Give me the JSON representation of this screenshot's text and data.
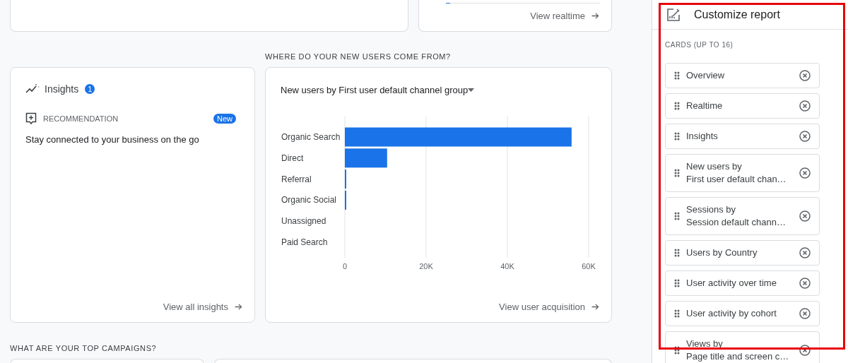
{
  "realtime_card": {
    "link": "View realtime"
  },
  "acquisition_section": {
    "heading": "WHERE DO YOUR NEW USERS COME FROM?",
    "insights_card": {
      "title": "Insights",
      "count": "1",
      "recommendation_label": "RECOMMENDATION",
      "badge": "New",
      "text": "Stay connected to your business on the go",
      "link": "View all insights"
    },
    "chart_card": {
      "title": "New users by First user default channel group",
      "link": "View user acquisition",
      "chart_data": {
        "type": "bar",
        "orientation": "horizontal",
        "categories": [
          "Organic Search",
          "Direct",
          "Referral",
          "Organic Social",
          "Unassigned",
          "Paid Search"
        ],
        "series": [
          {
            "color": "#1a73e8",
            "values": [
              55800,
              10400,
              300,
              300,
              0,
              0
            ]
          }
        ],
        "xlim": [
          0,
          60000
        ],
        "xticks": [
          {
            "value": 0,
            "label": "0"
          },
          {
            "value": 20000,
            "label": "20K"
          },
          {
            "value": 40000,
            "label": "40K"
          },
          {
            "value": 60000,
            "label": "60K"
          }
        ]
      }
    }
  },
  "campaigns_section": {
    "heading": "WHAT ARE YOUR TOP CAMPAIGNS?"
  },
  "customize_panel": {
    "title": "Customize report",
    "section_label": "CARDS (UP TO 16)",
    "highlight": true,
    "cards": [
      {
        "lines": [
          "Overview"
        ]
      },
      {
        "lines": [
          "Realtime"
        ]
      },
      {
        "lines": [
          "Insights"
        ]
      },
      {
        "lines": [
          "New users by",
          "First user default chan…"
        ]
      },
      {
        "lines": [
          "Sessions by",
          "Session default chann…"
        ]
      },
      {
        "lines": [
          "Users by Country"
        ]
      },
      {
        "lines": [
          "User activity over time"
        ]
      },
      {
        "lines": [
          "User activity by cohort"
        ]
      },
      {
        "lines": [
          "Views by",
          "Page title and screen c…"
        ]
      }
    ]
  }
}
